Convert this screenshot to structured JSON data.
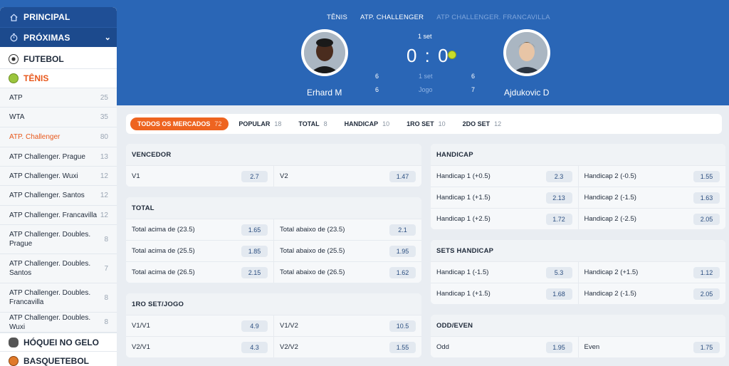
{
  "sidebar": {
    "principal": "PRINCIPAL",
    "proximas": "PRÓXIMAS",
    "futebol": "FUTEBOL",
    "tenis": "TÊNIS",
    "items": [
      {
        "label": "ATP",
        "count": "25"
      },
      {
        "label": "WTA",
        "count": "35"
      },
      {
        "label": "ATP. Challenger",
        "count": "80"
      },
      {
        "label": "ATP Challenger. Prague",
        "count": "13"
      },
      {
        "label": "ATP Challenger. Wuxi",
        "count": "12"
      },
      {
        "label": "ATP Challenger. Santos",
        "count": "12"
      },
      {
        "label": "ATP Challenger. Francavilla",
        "count": "12"
      },
      {
        "label": "ATP Challenger. Doubles. Prague",
        "count": "8"
      },
      {
        "label": "ATP Challenger. Doubles. Santos",
        "count": "7"
      },
      {
        "label": "ATP Challenger. Doubles. Francavilla",
        "count": "8"
      },
      {
        "label": "ATP Challenger. Doubles. Wuxi",
        "count": "8"
      }
    ],
    "hoquei": "HÓQUEI NO GELO",
    "basquete": "BASQUETEBOL"
  },
  "header": {
    "crumb1": "TÊNIS",
    "crumb2": "ATP. CHALLENGER",
    "crumb3": "ATP CHALLENGER. FRANCAVILLA",
    "set_label": "1 set",
    "score": "0 : 0",
    "player1": "Erhard M",
    "player2": "Ajdukovic D",
    "p1_set": "6",
    "p2_set": "6",
    "set_row_label": "1 set",
    "p1_game": "6",
    "p2_game": "7",
    "game_row_label": "Jogo"
  },
  "tabs": [
    {
      "label": "TODOS OS MERCADOS",
      "count": "72"
    },
    {
      "label": "POPULAR",
      "count": "18"
    },
    {
      "label": "TOTAL",
      "count": "8"
    },
    {
      "label": "HANDICAP",
      "count": "10"
    },
    {
      "label": "1RO SET",
      "count": "10"
    },
    {
      "label": "2DO SET",
      "count": "12"
    }
  ],
  "markets": {
    "vencedor": {
      "title": "VENCEDOR",
      "rows": [
        [
          "V1",
          "2.7",
          "V2",
          "1.47"
        ]
      ]
    },
    "total": {
      "title": "TOTAL",
      "rows": [
        [
          "Total acima de (23.5)",
          "1.65",
          "Total abaixo de (23.5)",
          "2.1"
        ],
        [
          "Total acima de (25.5)",
          "1.85",
          "Total abaixo de (25.5)",
          "1.95"
        ],
        [
          "Total acima de (26.5)",
          "2.15",
          "Total abaixo de (26.5)",
          "1.62"
        ]
      ]
    },
    "set_jogo": {
      "title": "1RO SET/JOGO",
      "rows": [
        [
          "V1/V1",
          "4.9",
          "V1/V2",
          "10.5"
        ],
        [
          "V2/V1",
          "4.3",
          "V2/V2",
          "1.55"
        ]
      ]
    },
    "handicap": {
      "title": "HANDICAP",
      "rows": [
        [
          "Handicap 1 (+0.5)",
          "2.3",
          "Handicap 2 (-0.5)",
          "1.55"
        ],
        [
          "Handicap 1 (+1.5)",
          "2.13",
          "Handicap 2 (-1.5)",
          "1.63"
        ],
        [
          "Handicap 1 (+2.5)",
          "1.72",
          "Handicap 2 (-2.5)",
          "2.05"
        ]
      ]
    },
    "sets_handicap": {
      "title": "SETS HANDICAP",
      "rows": [
        [
          "Handicap 1 (-1.5)",
          "5.3",
          "Handicap 2 (+1.5)",
          "1.12"
        ],
        [
          "Handicap 1 (+1.5)",
          "1.68",
          "Handicap 2 (-1.5)",
          "2.05"
        ]
      ]
    },
    "odd_even": {
      "title": "ODD/EVEN",
      "rows": [
        [
          "Odd",
          "1.95",
          "Even",
          "1.75"
        ]
      ]
    }
  },
  "colors": {
    "brand": "#2a66b6",
    "accent": "#ee6420",
    "nav": "#1f4f96"
  }
}
